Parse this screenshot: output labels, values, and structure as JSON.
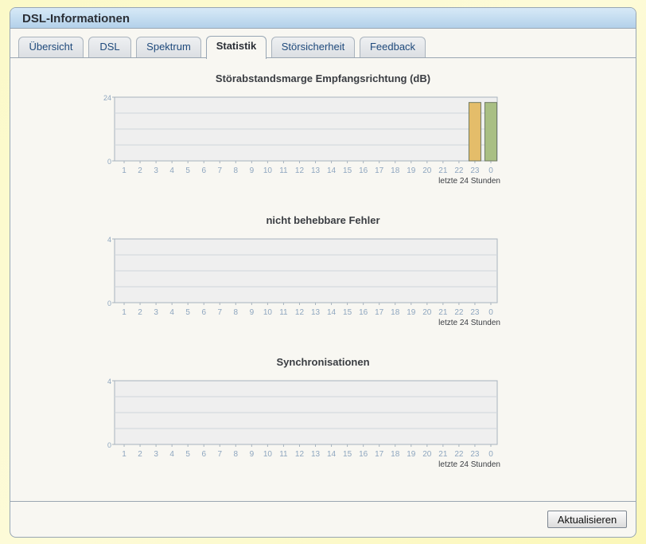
{
  "panel": {
    "title": "DSL-Informationen"
  },
  "tabs": [
    {
      "label": "Übersicht"
    },
    {
      "label": "DSL"
    },
    {
      "label": "Spektrum"
    },
    {
      "label": "Statistik",
      "active": true
    },
    {
      "label": "Störsicherheit"
    },
    {
      "label": "Feedback"
    }
  ],
  "charts": [
    {
      "title": "Störabstandsmarge Empfangsrichtung (dB)"
    },
    {
      "title": "nicht behebbare Fehler"
    },
    {
      "title": "Synchronisationen"
    }
  ],
  "chart_data": [
    {
      "type": "bar",
      "title": "Störabstandsmarge Empfangsrichtung (dB)",
      "xlabel": "letzte 24 Stunden",
      "categories": [
        "1",
        "2",
        "3",
        "4",
        "5",
        "6",
        "7",
        "8",
        "9",
        "10",
        "11",
        "12",
        "13",
        "14",
        "15",
        "16",
        "17",
        "18",
        "19",
        "20",
        "21",
        "22",
        "23",
        "0"
      ],
      "ylim": [
        0,
        24
      ],
      "yticks": [
        "0",
        "24"
      ],
      "values": [
        null,
        null,
        null,
        null,
        null,
        null,
        null,
        null,
        null,
        null,
        null,
        null,
        null,
        null,
        null,
        null,
        null,
        null,
        null,
        null,
        null,
        null,
        22,
        22
      ],
      "bar_colors": [
        "#e4bd6a",
        "#a9bf84"
      ]
    },
    {
      "type": "bar",
      "title": "nicht behebbare Fehler",
      "xlabel": "letzte 24 Stunden",
      "categories": [
        "1",
        "2",
        "3",
        "4",
        "5",
        "6",
        "7",
        "8",
        "9",
        "10",
        "11",
        "12",
        "13",
        "14",
        "15",
        "16",
        "17",
        "18",
        "19",
        "20",
        "21",
        "22",
        "23",
        "0"
      ],
      "ylim": [
        0,
        4
      ],
      "yticks": [
        "0",
        "4"
      ],
      "values": [
        null,
        null,
        null,
        null,
        null,
        null,
        null,
        null,
        null,
        null,
        null,
        null,
        null,
        null,
        null,
        null,
        null,
        null,
        null,
        null,
        null,
        null,
        null,
        null
      ]
    },
    {
      "type": "bar",
      "title": "Synchronisationen",
      "xlabel": "letzte 24 Stunden",
      "categories": [
        "1",
        "2",
        "3",
        "4",
        "5",
        "6",
        "7",
        "8",
        "9",
        "10",
        "11",
        "12",
        "13",
        "14",
        "15",
        "16",
        "17",
        "18",
        "19",
        "20",
        "21",
        "22",
        "23",
        "0"
      ],
      "ylim": [
        0,
        4
      ],
      "yticks": [
        "0",
        "4"
      ],
      "values": [
        null,
        null,
        null,
        null,
        null,
        null,
        null,
        null,
        null,
        null,
        null,
        null,
        null,
        null,
        null,
        null,
        null,
        null,
        null,
        null,
        null,
        null,
        null,
        null
      ]
    }
  ],
  "footer": {
    "refresh_label": "Aktualisieren"
  },
  "colors": {
    "header": "#b3d1ea",
    "tab_text": "#1f4a7c",
    "plot_bg": "#efefef",
    "gridline": "#cfd5db",
    "axis_label": "#8ea6bf"
  }
}
